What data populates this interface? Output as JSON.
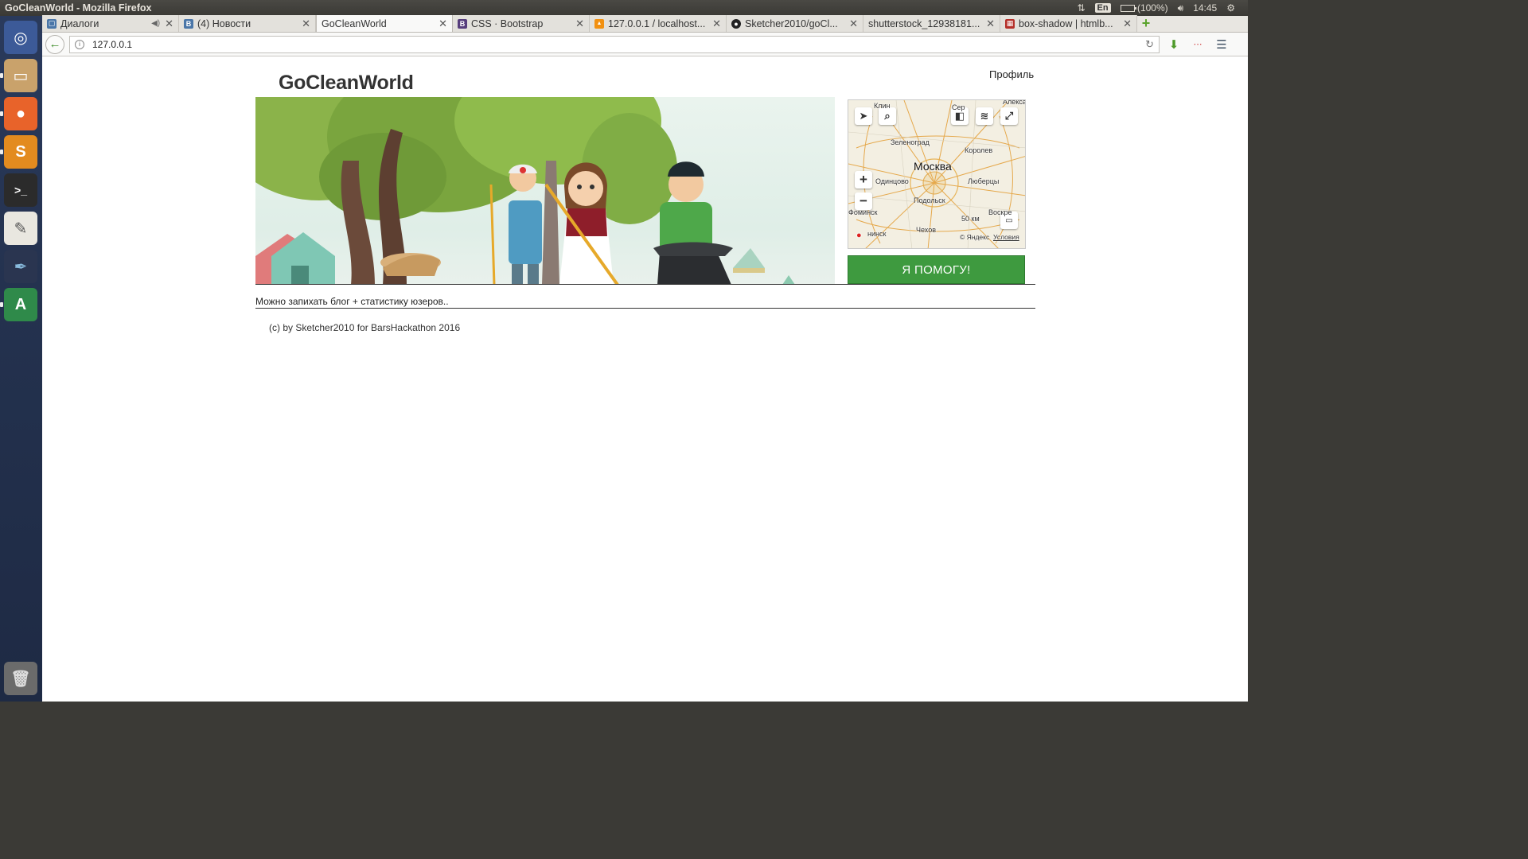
{
  "system": {
    "window_title": "GoCleanWorld - Mozilla Firefox",
    "keyboard_layout": "En",
    "battery": "(100%)",
    "clock": "14:45"
  },
  "browser": {
    "tabs": [
      {
        "title": "Диалоги",
        "favicon": "vk-dialogs-icon",
        "color": "#4a76a8",
        "audio": true
      },
      {
        "title": "(4) Новости",
        "favicon": "vk-icon",
        "color": "#4a76a8"
      },
      {
        "title": "GoCleanWorld",
        "favicon": "",
        "color": "",
        "active": true
      },
      {
        "title": "CSS · Bootstrap",
        "favicon": "bootstrap-icon",
        "color": "#563d7c"
      },
      {
        "title": "127.0.0.1 / localhost...",
        "favicon": "phpmyadmin-icon",
        "color": "#f29111"
      },
      {
        "title": "Sketcher2010/goCl...",
        "favicon": "github-icon",
        "color": "#222222"
      },
      {
        "title": "shutterstock_12938181...",
        "favicon": "",
        "color": ""
      },
      {
        "title": "box-shadow | htmlb...",
        "favicon": "htmlbook-icon",
        "color": "#b5302a"
      }
    ],
    "url": "127.0.0.1"
  },
  "page": {
    "brand": "GoCleanWorld",
    "profile_link": "Профиль",
    "help_button": "Я ПОМОГУ!",
    "note": "Можно запихать блог + статистику юзеров..",
    "footer": "(c) by Sketcher2010 for BarsHackathon 2016",
    "map": {
      "city": "Москва",
      "labels": [
        "Клин",
        "Сер",
        "Алекса",
        "Зеленоград",
        "Королев",
        "Одинцово",
        "Люберцы",
        "Подольск",
        "Фоминск",
        "Воскре",
        "Чехов",
        "нинск"
      ],
      "scale": "50 км",
      "copyright": "© Яндекс",
      "terms": "Условия"
    }
  },
  "colors": {
    "accent_green": "#3e9a3f",
    "launcher": "#24324f"
  }
}
